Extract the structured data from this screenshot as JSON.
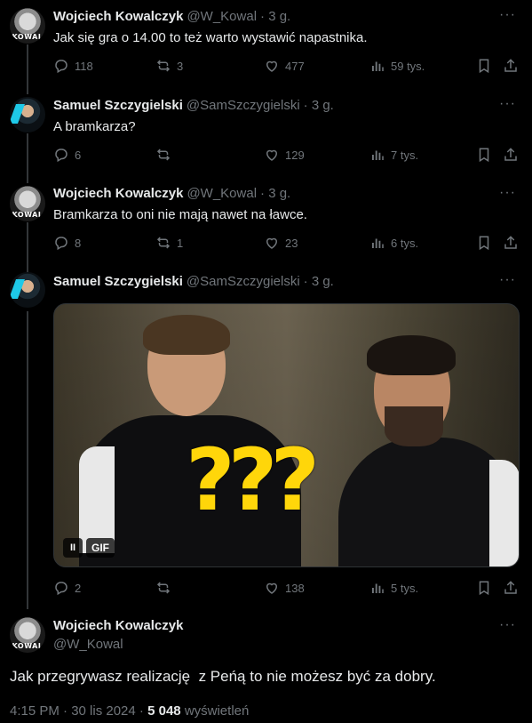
{
  "replies": [
    {
      "name": "Wojciech Kowalczyk",
      "handle": "@W_Kowal",
      "time": "· 3 g.",
      "text": "Jak się gra o 14.00 to też warto wystawić napastnika.",
      "replies": "118",
      "reposts": "3",
      "likes": "477",
      "views": "59 tys.",
      "avatar_text": "KOWAL"
    },
    {
      "name": "Samuel Szczygielski",
      "handle": "@SamSzczygielski",
      "time": "· 3 g.",
      "text": "A bramkarza?",
      "replies": "6",
      "reposts": "",
      "likes": "129",
      "views": "7 tys."
    },
    {
      "name": "Wojciech Kowalczyk",
      "handle": "@W_Kowal",
      "time": "· 3 g.",
      "text": "Bramkarza to oni nie mają nawet na ławce.",
      "replies": "8",
      "reposts": "1",
      "likes": "23",
      "views": "6 tys.",
      "avatar_text": "KOWAL"
    },
    {
      "name": "Samuel Szczygielski",
      "handle": "@SamSzczygielski",
      "time": "· 3 g.",
      "text": "",
      "replies": "2",
      "reposts": "",
      "likes": "138",
      "views": "5 tys.",
      "media": {
        "question_marks": "???",
        "gif_label": "GIF",
        "pause_label": "II"
      }
    }
  ],
  "main": {
    "name": "Wojciech Kowalczyk",
    "handle": "@W_Kowal",
    "avatar_text": "KOWAL",
    "text": "Jak przegrywasz realizację  z Peńą to nie możesz być za dobry.",
    "timestamp": "4:15 PM · 30 lis 2024 ·",
    "views_count": "5 048",
    "views_label": "wyświetleń"
  },
  "more_label": "···",
  "colors": {
    "background": "#000000",
    "text": "#e7e9ea",
    "secondary": "#71767b",
    "thread_line": "#333639",
    "question_marks": "#ffd60a"
  }
}
